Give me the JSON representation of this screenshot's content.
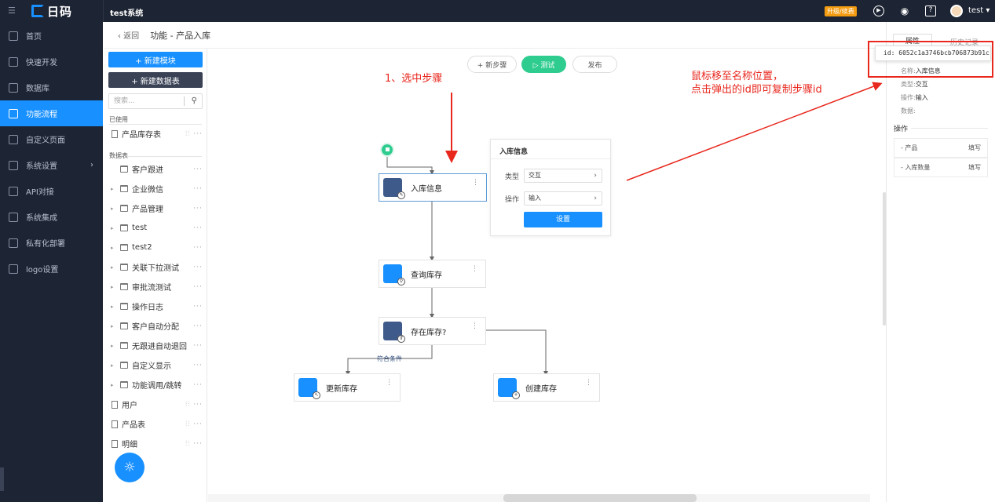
{
  "topbar": {
    "logo_text": "日码",
    "system_name": "test系统",
    "upgrade_label": "升级/续费",
    "user_name": "test ▾"
  },
  "nav": {
    "items": [
      {
        "label": "首页"
      },
      {
        "label": "快速开发"
      },
      {
        "label": "数据库"
      },
      {
        "label": "功能流程"
      },
      {
        "label": "自定义页面"
      },
      {
        "label": "系统设置"
      },
      {
        "label": "API对接"
      },
      {
        "label": "系统集成"
      },
      {
        "label": "私有化部署"
      },
      {
        "label": "logo设置"
      }
    ]
  },
  "breadcrumb": {
    "back": "‹ 返回",
    "title": "功能 - 产品入库"
  },
  "tree": {
    "new_module": "+ 新建模块",
    "new_table": "+ 新建数据表",
    "search_placeholder": "搜索...",
    "used_section": "已使用",
    "tables_section": "数据表",
    "used_items": [
      {
        "label": "产品库存表"
      }
    ],
    "folders": [
      {
        "label": "客户跟进"
      },
      {
        "label": "企业微信"
      },
      {
        "label": "产品管理"
      },
      {
        "label": "test"
      },
      {
        "label": "test2"
      },
      {
        "label": "关联下拉测试"
      },
      {
        "label": "审批流测试"
      },
      {
        "label": "操作日志"
      },
      {
        "label": "客户自动分配"
      },
      {
        "label": "无跟进自动退回"
      },
      {
        "label": "自定义显示"
      },
      {
        "label": "功能调用/跳转"
      }
    ],
    "docs": [
      {
        "label": "用户"
      },
      {
        "label": "产品表"
      },
      {
        "label": "明细"
      }
    ]
  },
  "toolbar": {
    "new_step": "+ 新步骤",
    "test": "▷ 测试",
    "publish": "发布"
  },
  "flow": {
    "nodes": {
      "inbound": "入库信息",
      "query": "查询库存",
      "exists": "存在库存?",
      "update": "更新库存",
      "create": "创建库存"
    },
    "branch_label": "符合条件"
  },
  "info_panel": {
    "title": "入库信息",
    "type_label": "类型",
    "type_value": "交互",
    "op_label": "操作",
    "op_value": "输入",
    "button": "设置"
  },
  "annotations": {
    "step1": "1、选中步骤",
    "hint_line1": "鼠标移至名称位置，",
    "hint_line2": "点击弹出的id即可复制步骤id"
  },
  "right_panel": {
    "tab_active": "属性",
    "tab_history": "历史记录",
    "id_tip": "id: 6052c1a3746bcb706873b91c",
    "name_key": "名称:",
    "name_val": "入库信息",
    "type_key": "类型:",
    "type_val": "交互",
    "op_key": "操作:",
    "op_val": "输入",
    "data_key": "数据:",
    "ops_section": "操作",
    "ops": [
      {
        "k": "- 产品",
        "v": "填写"
      },
      {
        "k": "- 入库数量",
        "v": "填写"
      }
    ]
  },
  "colors": {
    "topbar_bg": "#1d2433",
    "accent": "#1890ff",
    "success": "#2ecc8f",
    "annotation": "#e8271d"
  }
}
